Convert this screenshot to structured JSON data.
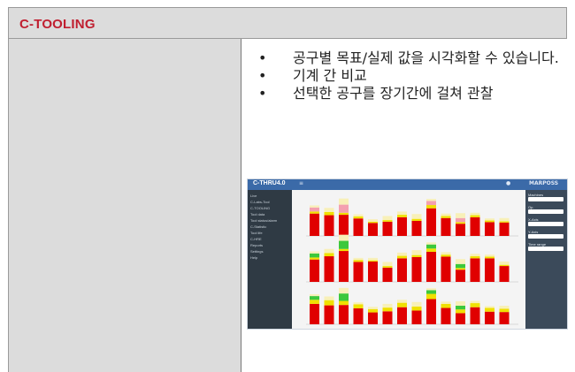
{
  "header": {
    "title": "C-TOOLING"
  },
  "features": [
    {
      "bullet": "•",
      "text": "공구별 목표/실제 값을 시각화할 수 있습니다."
    },
    {
      "bullet": "•",
      "text": "기계 간 비교"
    },
    {
      "bullet": "•",
      "text": "선택한 공구를 장기간에 걸쳐 관찰"
    }
  ],
  "screenshot": {
    "brand": "C-THRU4.0",
    "topbar_right": "MARPOSS",
    "sidebar_items": [
      "Live",
      "C-Labs-Tool",
      "C-TOOLING",
      "Tool data",
      "Tool status/alarm",
      "C-Statistic",
      "Tool life",
      "C-HRE",
      "Reports",
      "Settings",
      "Help"
    ],
    "right_panel_labels": [
      "Machines",
      "Op.",
      "X-Axis",
      "Y-Axis",
      "Time range"
    ],
    "colors": {
      "red": "#e00000",
      "yellow": "#f0e000",
      "green": "#3cc83c",
      "pink": "#f4a0b0",
      "cream": "#f8f0b8"
    }
  }
}
